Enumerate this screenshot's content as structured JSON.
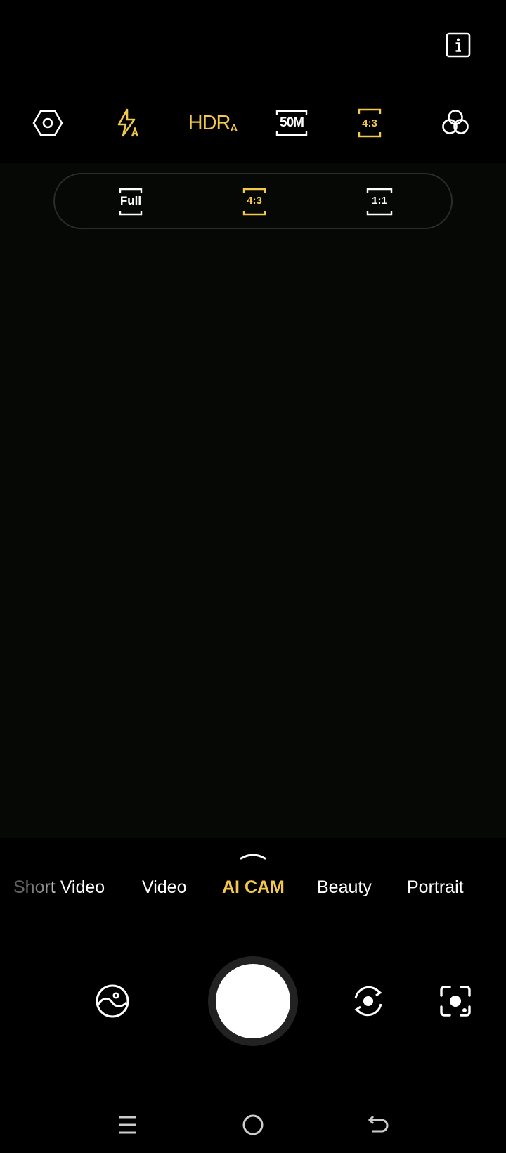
{
  "colors": {
    "accent": "#f2c94c",
    "icon": "#ffffff",
    "background": "#000000"
  },
  "info": {
    "icon": "info-icon"
  },
  "top_bar": {
    "items": [
      {
        "icon": "settings-hexagon-icon"
      },
      {
        "icon": "flash-auto-icon"
      },
      {
        "icon": "hdr-auto-icon",
        "label": "HDR",
        "sub": "A"
      },
      {
        "icon": "resolution-icon",
        "label": "50M"
      },
      {
        "icon": "aspect-ratio-icon",
        "label": "4:3"
      },
      {
        "icon": "filters-icon"
      }
    ]
  },
  "ratio_panel": {
    "options": [
      {
        "label": "Full",
        "selected": false
      },
      {
        "label": "4:3",
        "selected": true
      },
      {
        "label": "1:1",
        "selected": false
      }
    ]
  },
  "modes": {
    "items": [
      {
        "label": "Short Video"
      },
      {
        "label": "Video"
      },
      {
        "label": "AI CAM",
        "active": true
      },
      {
        "label": "Beauty"
      },
      {
        "label": "Portrait"
      }
    ]
  },
  "controls": {
    "gallery": "gallery-icon",
    "shutter": "shutter-button",
    "switch_camera": "switch-camera-icon",
    "lens": "google-lens-icon"
  },
  "nav": {
    "menu": "menu-icon",
    "home": "home-icon",
    "back": "back-icon"
  }
}
